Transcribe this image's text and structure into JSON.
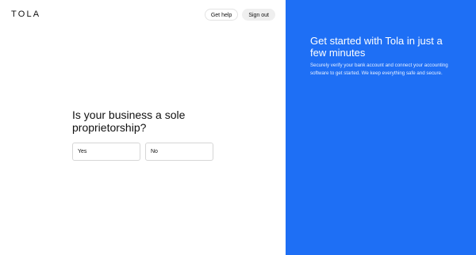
{
  "header": {
    "logo": "TOLA",
    "get_help_label": "Get help",
    "sign_out_label": "Sign out"
  },
  "main": {
    "question": "Is your business a sole proprietorship?",
    "options": [
      {
        "label": "Yes"
      },
      {
        "label": "No"
      }
    ]
  },
  "side_panel": {
    "title": "Get started with Tola in just a few minutes",
    "description": "Securely verify your bank account and connect your accounting software to get started. We keep everything safe and secure.",
    "background_color": "#1e6ff5"
  }
}
